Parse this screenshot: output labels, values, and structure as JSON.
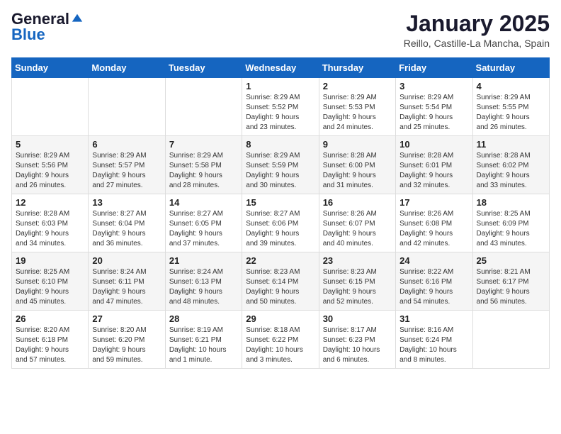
{
  "logo": {
    "general": "General",
    "blue": "Blue"
  },
  "header": {
    "title": "January 2025",
    "subtitle": "Reillo, Castille-La Mancha, Spain"
  },
  "weekdays": [
    "Sunday",
    "Monday",
    "Tuesday",
    "Wednesday",
    "Thursday",
    "Friday",
    "Saturday"
  ],
  "weeks": [
    [
      {
        "day": "",
        "info": ""
      },
      {
        "day": "",
        "info": ""
      },
      {
        "day": "",
        "info": ""
      },
      {
        "day": "1",
        "info": "Sunrise: 8:29 AM\nSunset: 5:52 PM\nDaylight: 9 hours\nand 23 minutes."
      },
      {
        "day": "2",
        "info": "Sunrise: 8:29 AM\nSunset: 5:53 PM\nDaylight: 9 hours\nand 24 minutes."
      },
      {
        "day": "3",
        "info": "Sunrise: 8:29 AM\nSunset: 5:54 PM\nDaylight: 9 hours\nand 25 minutes."
      },
      {
        "day": "4",
        "info": "Sunrise: 8:29 AM\nSunset: 5:55 PM\nDaylight: 9 hours\nand 26 minutes."
      }
    ],
    [
      {
        "day": "5",
        "info": "Sunrise: 8:29 AM\nSunset: 5:56 PM\nDaylight: 9 hours\nand 26 minutes."
      },
      {
        "day": "6",
        "info": "Sunrise: 8:29 AM\nSunset: 5:57 PM\nDaylight: 9 hours\nand 27 minutes."
      },
      {
        "day": "7",
        "info": "Sunrise: 8:29 AM\nSunset: 5:58 PM\nDaylight: 9 hours\nand 28 minutes."
      },
      {
        "day": "8",
        "info": "Sunrise: 8:29 AM\nSunset: 5:59 PM\nDaylight: 9 hours\nand 30 minutes."
      },
      {
        "day": "9",
        "info": "Sunrise: 8:28 AM\nSunset: 6:00 PM\nDaylight: 9 hours\nand 31 minutes."
      },
      {
        "day": "10",
        "info": "Sunrise: 8:28 AM\nSunset: 6:01 PM\nDaylight: 9 hours\nand 32 minutes."
      },
      {
        "day": "11",
        "info": "Sunrise: 8:28 AM\nSunset: 6:02 PM\nDaylight: 9 hours\nand 33 minutes."
      }
    ],
    [
      {
        "day": "12",
        "info": "Sunrise: 8:28 AM\nSunset: 6:03 PM\nDaylight: 9 hours\nand 34 minutes."
      },
      {
        "day": "13",
        "info": "Sunrise: 8:27 AM\nSunset: 6:04 PM\nDaylight: 9 hours\nand 36 minutes."
      },
      {
        "day": "14",
        "info": "Sunrise: 8:27 AM\nSunset: 6:05 PM\nDaylight: 9 hours\nand 37 minutes."
      },
      {
        "day": "15",
        "info": "Sunrise: 8:27 AM\nSunset: 6:06 PM\nDaylight: 9 hours\nand 39 minutes."
      },
      {
        "day": "16",
        "info": "Sunrise: 8:26 AM\nSunset: 6:07 PM\nDaylight: 9 hours\nand 40 minutes."
      },
      {
        "day": "17",
        "info": "Sunrise: 8:26 AM\nSunset: 6:08 PM\nDaylight: 9 hours\nand 42 minutes."
      },
      {
        "day": "18",
        "info": "Sunrise: 8:25 AM\nSunset: 6:09 PM\nDaylight: 9 hours\nand 43 minutes."
      }
    ],
    [
      {
        "day": "19",
        "info": "Sunrise: 8:25 AM\nSunset: 6:10 PM\nDaylight: 9 hours\nand 45 minutes."
      },
      {
        "day": "20",
        "info": "Sunrise: 8:24 AM\nSunset: 6:11 PM\nDaylight: 9 hours\nand 47 minutes."
      },
      {
        "day": "21",
        "info": "Sunrise: 8:24 AM\nSunset: 6:13 PM\nDaylight: 9 hours\nand 48 minutes."
      },
      {
        "day": "22",
        "info": "Sunrise: 8:23 AM\nSunset: 6:14 PM\nDaylight: 9 hours\nand 50 minutes."
      },
      {
        "day": "23",
        "info": "Sunrise: 8:23 AM\nSunset: 6:15 PM\nDaylight: 9 hours\nand 52 minutes."
      },
      {
        "day": "24",
        "info": "Sunrise: 8:22 AM\nSunset: 6:16 PM\nDaylight: 9 hours\nand 54 minutes."
      },
      {
        "day": "25",
        "info": "Sunrise: 8:21 AM\nSunset: 6:17 PM\nDaylight: 9 hours\nand 56 minutes."
      }
    ],
    [
      {
        "day": "26",
        "info": "Sunrise: 8:20 AM\nSunset: 6:18 PM\nDaylight: 9 hours\nand 57 minutes."
      },
      {
        "day": "27",
        "info": "Sunrise: 8:20 AM\nSunset: 6:20 PM\nDaylight: 9 hours\nand 59 minutes."
      },
      {
        "day": "28",
        "info": "Sunrise: 8:19 AM\nSunset: 6:21 PM\nDaylight: 10 hours\nand 1 minute."
      },
      {
        "day": "29",
        "info": "Sunrise: 8:18 AM\nSunset: 6:22 PM\nDaylight: 10 hours\nand 3 minutes."
      },
      {
        "day": "30",
        "info": "Sunrise: 8:17 AM\nSunset: 6:23 PM\nDaylight: 10 hours\nand 6 minutes."
      },
      {
        "day": "31",
        "info": "Sunrise: 8:16 AM\nSunset: 6:24 PM\nDaylight: 10 hours\nand 8 minutes."
      },
      {
        "day": "",
        "info": ""
      }
    ]
  ]
}
